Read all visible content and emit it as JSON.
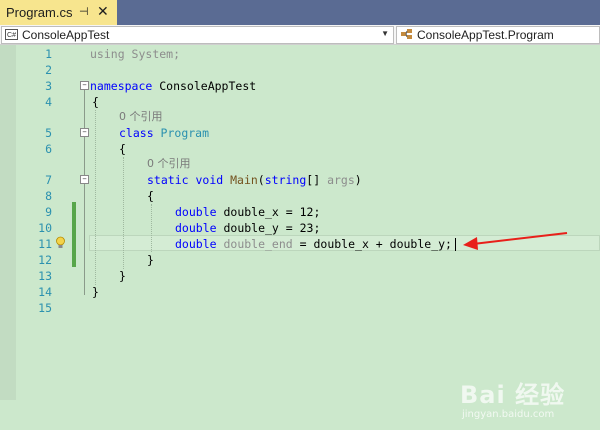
{
  "tab": {
    "title": "Program.cs",
    "pin": "⊣",
    "close": "✕"
  },
  "nav": {
    "project": "ConsoleAppTest",
    "class_path": "ConsoleAppTest.Program",
    "project_icon": "C#",
    "class_icon": "class-icon"
  },
  "editor": {
    "line_numbers": [
      "1",
      "2",
      "3",
      "4",
      "5",
      "6",
      "7",
      "8",
      "9",
      "10",
      "11",
      "12",
      "13",
      "14",
      "15"
    ],
    "codelens_ref": "0 个引用",
    "code": {
      "using_kw": "using",
      "using_rest": " System;",
      "namespace_kw": "namespace",
      "namespace_name": " ConsoleAppTest",
      "brace_open": "{",
      "brace_close": "}",
      "class_kw": "class",
      "class_name": " Program",
      "static_kw": "static",
      "void_kw": " void",
      "main_name": " Main",
      "main_paren": "(",
      "string_kw": "string",
      "main_args": "[] ",
      "args_name": "args",
      "main_close": ")",
      "double_kw": "double",
      "line9_rest": " double_x = 12;",
      "line10_rest": " double_y = 23;",
      "line11_var": " double_end",
      "line11_rest": " = double_x + double_y;"
    }
  },
  "watermark": {
    "brand": "Bai 经验",
    "url": "jingyan.baidu.com"
  },
  "annotation": {
    "color": "#e8201a"
  }
}
